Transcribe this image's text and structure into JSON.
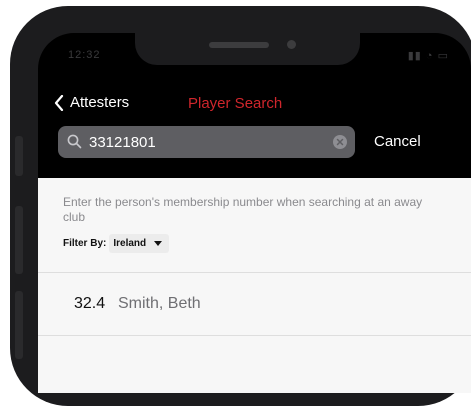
{
  "status_bar": {
    "time": "12:32",
    "indicators": "▮▮ ◔ ▭"
  },
  "nav": {
    "back_label": "Attesters",
    "title": "Player Search"
  },
  "search": {
    "value": "33121801",
    "cancel_label": "Cancel"
  },
  "content": {
    "hint": "Enter the person's membership number when searching at an away club",
    "filter_label": "Filter By:",
    "filter_value": "Ireland"
  },
  "results": [
    {
      "handicap": "32.4",
      "name": "Smith, Beth"
    }
  ],
  "colors": {
    "accent": "#d0262c",
    "search_bg": "#5e5e62",
    "content_bg": "#f7f7f7"
  }
}
